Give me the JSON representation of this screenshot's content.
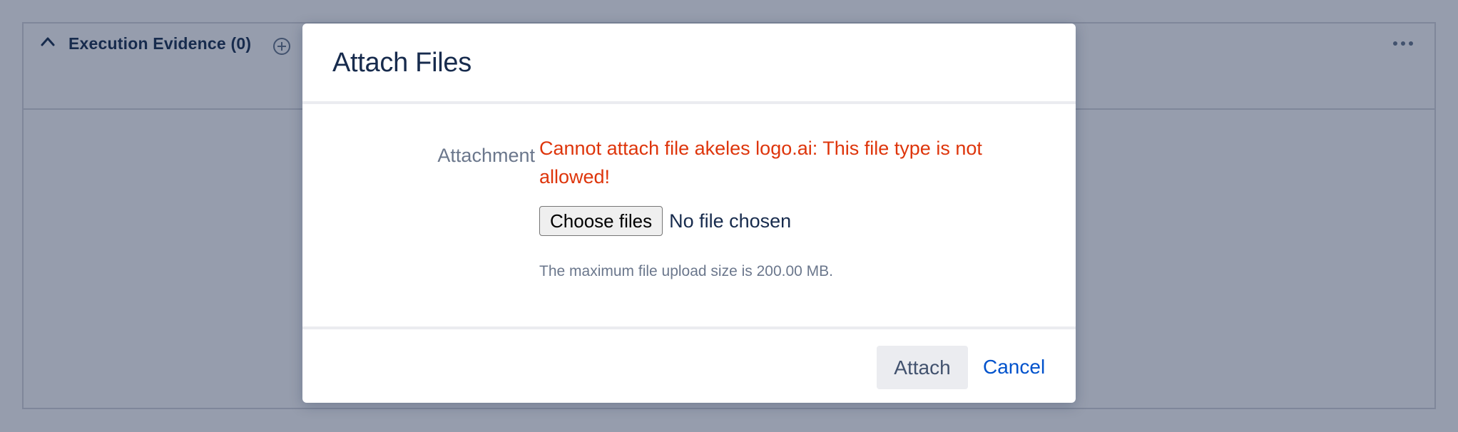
{
  "background": {
    "section_title": "Execution Evidence (0)",
    "icons": [
      "chevron-up-icon",
      "add-circle-icon",
      "more-horizontal-icon"
    ]
  },
  "dialog": {
    "title": "Attach Files",
    "field_label": "Attachment",
    "error_message": "Cannot attach file akeles logo.ai: This file type is not allowed!",
    "choose_button_label": "Choose files",
    "no_file_text": "No file chosen",
    "help_text": "The maximum file upload size is 200.00 MB.",
    "attach_label": "Attach",
    "cancel_label": "Cancel"
  },
  "colors": {
    "overlay": "#969dad",
    "error": "#de350b",
    "link": "#0052cc",
    "heading": "#172b4d"
  }
}
